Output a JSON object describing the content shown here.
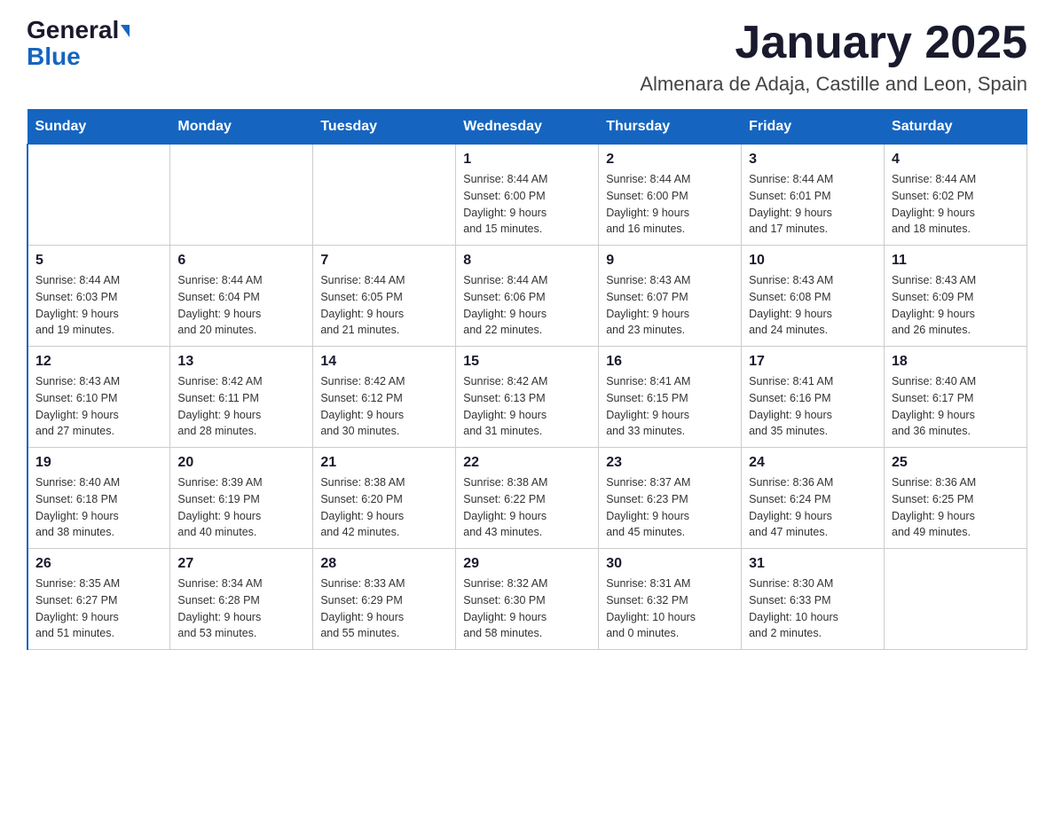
{
  "header": {
    "logo_general": "General",
    "logo_blue": "Blue",
    "title": "January 2025",
    "subtitle": "Almenara de Adaja, Castille and Leon, Spain"
  },
  "weekdays": [
    "Sunday",
    "Monday",
    "Tuesday",
    "Wednesday",
    "Thursday",
    "Friday",
    "Saturday"
  ],
  "weeks": [
    [
      {
        "day": "",
        "info": ""
      },
      {
        "day": "",
        "info": ""
      },
      {
        "day": "",
        "info": ""
      },
      {
        "day": "1",
        "info": "Sunrise: 8:44 AM\nSunset: 6:00 PM\nDaylight: 9 hours\nand 15 minutes."
      },
      {
        "day": "2",
        "info": "Sunrise: 8:44 AM\nSunset: 6:00 PM\nDaylight: 9 hours\nand 16 minutes."
      },
      {
        "day": "3",
        "info": "Sunrise: 8:44 AM\nSunset: 6:01 PM\nDaylight: 9 hours\nand 17 minutes."
      },
      {
        "day": "4",
        "info": "Sunrise: 8:44 AM\nSunset: 6:02 PM\nDaylight: 9 hours\nand 18 minutes."
      }
    ],
    [
      {
        "day": "5",
        "info": "Sunrise: 8:44 AM\nSunset: 6:03 PM\nDaylight: 9 hours\nand 19 minutes."
      },
      {
        "day": "6",
        "info": "Sunrise: 8:44 AM\nSunset: 6:04 PM\nDaylight: 9 hours\nand 20 minutes."
      },
      {
        "day": "7",
        "info": "Sunrise: 8:44 AM\nSunset: 6:05 PM\nDaylight: 9 hours\nand 21 minutes."
      },
      {
        "day": "8",
        "info": "Sunrise: 8:44 AM\nSunset: 6:06 PM\nDaylight: 9 hours\nand 22 minutes."
      },
      {
        "day": "9",
        "info": "Sunrise: 8:43 AM\nSunset: 6:07 PM\nDaylight: 9 hours\nand 23 minutes."
      },
      {
        "day": "10",
        "info": "Sunrise: 8:43 AM\nSunset: 6:08 PM\nDaylight: 9 hours\nand 24 minutes."
      },
      {
        "day": "11",
        "info": "Sunrise: 8:43 AM\nSunset: 6:09 PM\nDaylight: 9 hours\nand 26 minutes."
      }
    ],
    [
      {
        "day": "12",
        "info": "Sunrise: 8:43 AM\nSunset: 6:10 PM\nDaylight: 9 hours\nand 27 minutes."
      },
      {
        "day": "13",
        "info": "Sunrise: 8:42 AM\nSunset: 6:11 PM\nDaylight: 9 hours\nand 28 minutes."
      },
      {
        "day": "14",
        "info": "Sunrise: 8:42 AM\nSunset: 6:12 PM\nDaylight: 9 hours\nand 30 minutes."
      },
      {
        "day": "15",
        "info": "Sunrise: 8:42 AM\nSunset: 6:13 PM\nDaylight: 9 hours\nand 31 minutes."
      },
      {
        "day": "16",
        "info": "Sunrise: 8:41 AM\nSunset: 6:15 PM\nDaylight: 9 hours\nand 33 minutes."
      },
      {
        "day": "17",
        "info": "Sunrise: 8:41 AM\nSunset: 6:16 PM\nDaylight: 9 hours\nand 35 minutes."
      },
      {
        "day": "18",
        "info": "Sunrise: 8:40 AM\nSunset: 6:17 PM\nDaylight: 9 hours\nand 36 minutes."
      }
    ],
    [
      {
        "day": "19",
        "info": "Sunrise: 8:40 AM\nSunset: 6:18 PM\nDaylight: 9 hours\nand 38 minutes."
      },
      {
        "day": "20",
        "info": "Sunrise: 8:39 AM\nSunset: 6:19 PM\nDaylight: 9 hours\nand 40 minutes."
      },
      {
        "day": "21",
        "info": "Sunrise: 8:38 AM\nSunset: 6:20 PM\nDaylight: 9 hours\nand 42 minutes."
      },
      {
        "day": "22",
        "info": "Sunrise: 8:38 AM\nSunset: 6:22 PM\nDaylight: 9 hours\nand 43 minutes."
      },
      {
        "day": "23",
        "info": "Sunrise: 8:37 AM\nSunset: 6:23 PM\nDaylight: 9 hours\nand 45 minutes."
      },
      {
        "day": "24",
        "info": "Sunrise: 8:36 AM\nSunset: 6:24 PM\nDaylight: 9 hours\nand 47 minutes."
      },
      {
        "day": "25",
        "info": "Sunrise: 8:36 AM\nSunset: 6:25 PM\nDaylight: 9 hours\nand 49 minutes."
      }
    ],
    [
      {
        "day": "26",
        "info": "Sunrise: 8:35 AM\nSunset: 6:27 PM\nDaylight: 9 hours\nand 51 minutes."
      },
      {
        "day": "27",
        "info": "Sunrise: 8:34 AM\nSunset: 6:28 PM\nDaylight: 9 hours\nand 53 minutes."
      },
      {
        "day": "28",
        "info": "Sunrise: 8:33 AM\nSunset: 6:29 PM\nDaylight: 9 hours\nand 55 minutes."
      },
      {
        "day": "29",
        "info": "Sunrise: 8:32 AM\nSunset: 6:30 PM\nDaylight: 9 hours\nand 58 minutes."
      },
      {
        "day": "30",
        "info": "Sunrise: 8:31 AM\nSunset: 6:32 PM\nDaylight: 10 hours\nand 0 minutes."
      },
      {
        "day": "31",
        "info": "Sunrise: 8:30 AM\nSunset: 6:33 PM\nDaylight: 10 hours\nand 2 minutes."
      },
      {
        "day": "",
        "info": ""
      }
    ]
  ]
}
